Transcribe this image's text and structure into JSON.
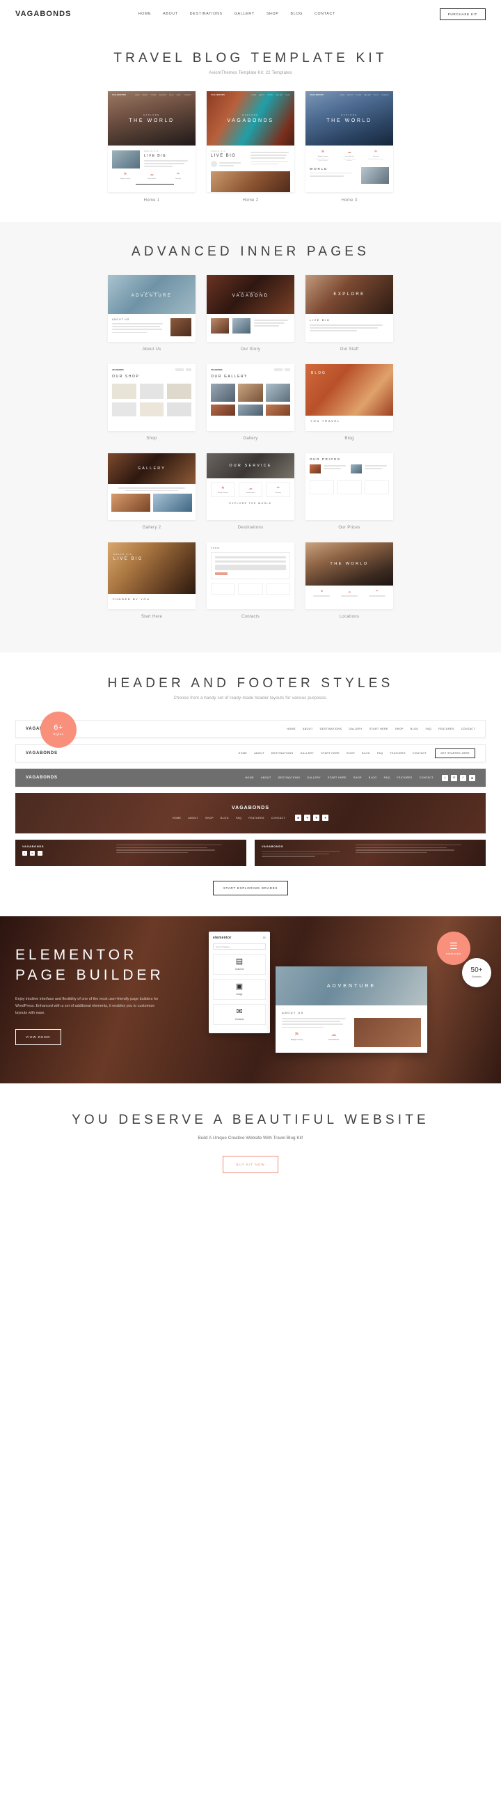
{
  "header": {
    "brand": "VAGABONDS",
    "nav": [
      "HOME",
      "ABOUT",
      "DESTINATIONS",
      "GALLERY",
      "SHOP",
      "BLOG",
      "CONTACT"
    ],
    "cta": "PURCHASE KIT"
  },
  "hero": {
    "title": "TRAVEL BLOG TEMPLATE KIT",
    "subtitle": "AxiomThemes Template Kit: 22 Templates"
  },
  "homes": {
    "cards": [
      {
        "label": "Home 1",
        "kicker": "EXPLORE",
        "headline": "THE WORLD",
        "body_kicker": "DREAM BIG",
        "body_title": "LIVE BIG"
      },
      {
        "label": "Home 2",
        "kicker": "EXPLORE",
        "headline": "VAGABONDS",
        "body_kicker": "DREAM BIG",
        "body_title": "LIVE BIG"
      },
      {
        "label": "Home 3",
        "kicker": "EXPLORE",
        "headline": "THE WORLD",
        "body_kicker": "",
        "body_title": "WORLD"
      }
    ],
    "mini_nav": [
      "HOME",
      "ABOUT",
      "TOURS",
      "GALLERY",
      "BLOG",
      "SHOP",
      "CONTACT"
    ],
    "feature_icons": [
      {
        "glyph": "⚑",
        "cap": "Bridge Country",
        "sub": "Discover hidden routes across the globe"
      },
      {
        "glyph": "☁",
        "cap": "Great Events",
        "sub": "Join trips with friendly travellers"
      },
      {
        "glyph": "☂",
        "cap": "Serenity",
        "sub": "Find peaceful places to rest"
      }
    ]
  },
  "inner": {
    "title": "ADVANCED INNER PAGES",
    "tiles": [
      {
        "label": "About Us",
        "kicker": "EXPLORE",
        "headline": "ADVENTURE",
        "sub": "ABOUT US"
      },
      {
        "label": "Our Story",
        "kicker": "WELCOME TO",
        "headline": "VAGABOND",
        "sub": ""
      },
      {
        "label": "Our Staff",
        "kicker": "",
        "headline": "EXPLORE",
        "sub": "LIVE BIG"
      },
      {
        "label": "Shop",
        "kicker": "",
        "headline": "OUR SHOP",
        "sub": ""
      },
      {
        "label": "Gallery",
        "kicker": "",
        "headline": "OUR GALLERY",
        "sub": ""
      },
      {
        "label": "Blog",
        "kicker": "",
        "headline": "BLOG",
        "sub": "YOU TRAVEL"
      },
      {
        "label": "Gallery 2",
        "kicker": "",
        "headline": "GALLERY",
        "sub": ""
      },
      {
        "label": "Destinations",
        "kicker": "",
        "headline": "OUR SERVICE",
        "sub": "EXPLORE THE WORLD"
      },
      {
        "label": "Our Prices",
        "kicker": "",
        "headline": "OUR PRICES",
        "sub": ""
      },
      {
        "label": "Start Here",
        "kicker": "DREAM BIG",
        "headline": "LIVE BIG",
        "sub": "FUNDED BY YOU"
      },
      {
        "label": "Contacts",
        "kicker": "FORM",
        "headline": "",
        "sub": ""
      },
      {
        "label": "Locations",
        "kicker": "",
        "headline": "THE WORLD",
        "sub": ""
      }
    ]
  },
  "headerfooter": {
    "title": "HEADER AND FOOTER STYLES",
    "subtitle": "Choose from a handy set of ready-made header layouts for various purposes.",
    "badge_number": "6+",
    "badge_caption": "Styles",
    "logo": "VAGABONDS",
    "menu": [
      "HOME",
      "ABOUT",
      "DESTINATIONS",
      "GALLERY",
      "START HERE",
      "SHOP",
      "BLOG",
      "FAQ",
      "FEATURES",
      "CONTACT"
    ],
    "bar_cta": "GET STARTED HERE",
    "socials": [
      "f",
      "✉",
      "✓",
      "■"
    ],
    "photo_menu": [
      "HOME",
      "ABOUT",
      "SHOP",
      "BLOG",
      "FAQ",
      "FEATURES",
      "CONTACT"
    ],
    "photo_socials": [
      "■",
      "♥",
      "▼",
      "●"
    ],
    "explore_button": "START EXPLORING GRADES"
  },
  "elementor": {
    "title_line1": "ELEMENTOR",
    "title_line2": "PAGE BUILDER",
    "text": "Enjoy intuitive interface and flexibility of one of the most user-friendly page builders for WordPress. Enhanced with a set of additional elements, it enables you to customize layouts with ease.",
    "button": "VIEW DEMO",
    "panel_brand": "elementor",
    "panel_search_placeholder": "Search Widget...",
    "widgets": [
      {
        "glyph": "▤",
        "label": "Columns"
      },
      {
        "glyph": "▣",
        "label": "Image"
      },
      {
        "glyph": "✉",
        "label": "Contacts"
      }
    ],
    "preview_headline": "ADVENTURE",
    "preview_kicker": "ABOUT US",
    "badge_orange_glyph": "☰",
    "badge_orange_text": "elementor",
    "badge_white_number": "50+",
    "badge_white_caption": "Elements"
  },
  "cta": {
    "title": "YOU DESERVE A BEAUTIFUL WEBSITE",
    "subtitle": "Build A Unique Creative Website With Travel Blog Kit!",
    "button": "BUY KIT NOW"
  },
  "colors": {
    "accent": "#f8907c",
    "ink": "#3c3c3c",
    "muted": "#8b8b8b",
    "panel_bg": "#f7f7f7"
  }
}
